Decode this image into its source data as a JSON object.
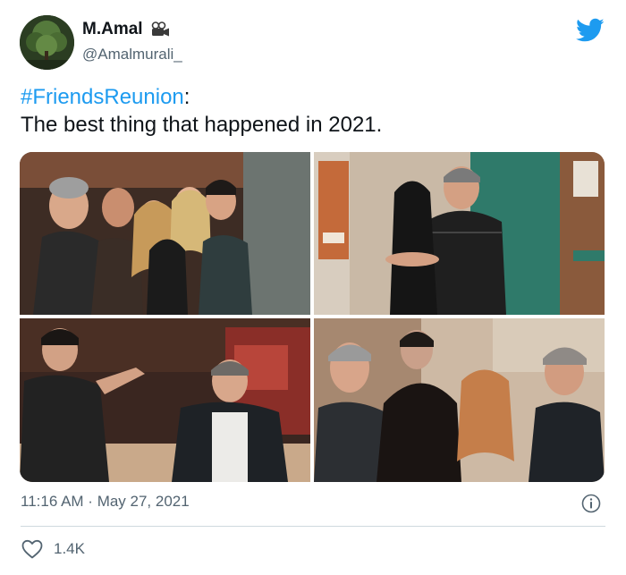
{
  "author": {
    "display_name": "M.Amal",
    "handle": "@Amalmurali_",
    "badge_icon": "movie-camera-icon",
    "avatar_icon": "tree-avatar"
  },
  "brand": {
    "icon": "twitter-bird-icon",
    "color": "#1d9bf0"
  },
  "tweet": {
    "hashtag": "#FriendsReunion",
    "hashtag_suffix": ":",
    "body": "The best thing that happened in 2021."
  },
  "media": {
    "photos": [
      {
        "icon": "group-selfie-photo"
      },
      {
        "icon": "hug-at-door-photo"
      },
      {
        "icon": "two-men-laughing-photo"
      },
      {
        "icon": "group-huddle-photo"
      }
    ]
  },
  "meta": {
    "time": "11:16 AM",
    "separator": " · ",
    "date": "May 27, 2021",
    "info_icon": "info-icon"
  },
  "engagement": {
    "likes_icon": "heart-icon",
    "likes": "1.4K"
  },
  "colors": {
    "text": "#0f1419",
    "secondary": "#536471",
    "link": "#1d9bf0",
    "divider": "#cfd9de"
  }
}
